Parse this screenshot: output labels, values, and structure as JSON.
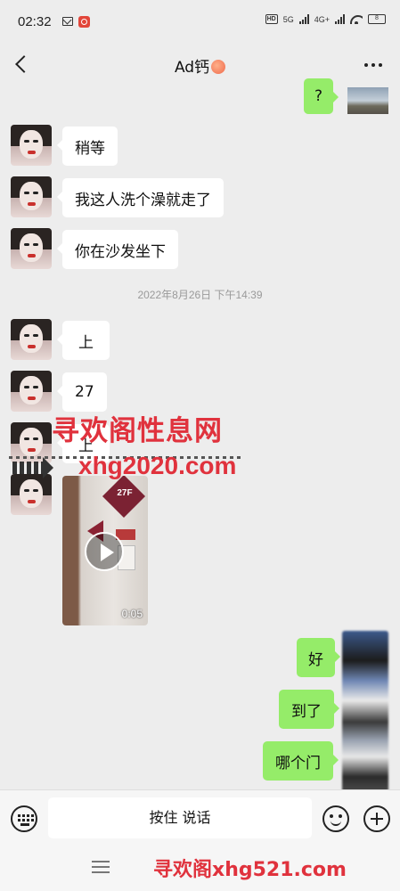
{
  "status_bar": {
    "time": "02:32",
    "network_1": "HD",
    "network_2": "5G",
    "network_3": "4G+",
    "battery": "8"
  },
  "header": {
    "title": "Ad钙",
    "title_emoji": "peach-emoji"
  },
  "messages": {
    "m0": "?",
    "m1": "稍等",
    "m2": "我这人洗个澡就走了",
    "m3": "你在沙发坐下",
    "timestamp": "2022年8月26日 下午14:39",
    "m4": "上",
    "m5": "27",
    "m6": "上",
    "video": {
      "sign_text": "27F",
      "duration": "0:05"
    },
    "m8": "好",
    "m9": "到了",
    "m10": "哪个门"
  },
  "watermarks": {
    "top_cn": "寻欢阁性息网",
    "top_url": "xhg2020.com",
    "bottom": "寻欢阁xhg521.com"
  },
  "input_bar": {
    "voice_label": "按住 说话"
  },
  "colors": {
    "background": "#ededed",
    "self_bubble": "#95ec69",
    "other_bubble": "#ffffff",
    "watermark": "#e0323d"
  }
}
